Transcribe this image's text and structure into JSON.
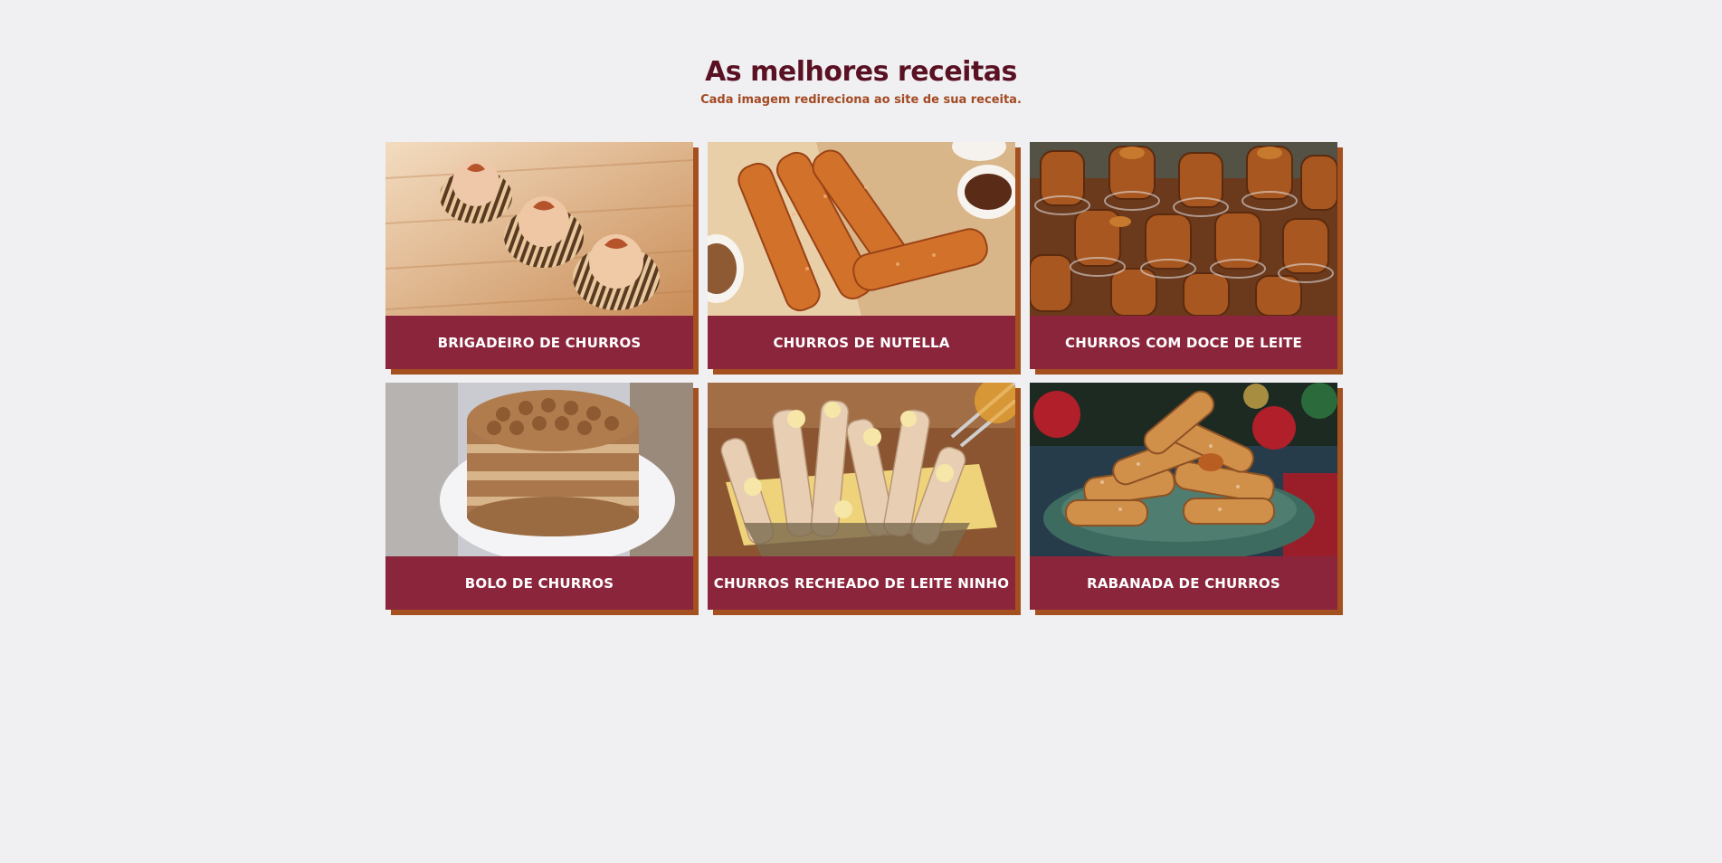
{
  "header": {
    "title": "As melhores receitas",
    "subtitle": "Cada imagem redireciona ao site de sua receita."
  },
  "recipes": [
    {
      "label": "BRIGADEIRO DE CHURROS"
    },
    {
      "label": "CHURROS DE NUTELLA"
    },
    {
      "label": "CHURROS COM DOCE DE LEITE"
    },
    {
      "label": "BOLO DE CHURROS"
    },
    {
      "label": "CHURROS RECHEADO DE LEITE NINHO"
    },
    {
      "label": "RABANADA DE CHURROS"
    }
  ],
  "colors": {
    "background": "#f0f0f2",
    "title": "#5a1123",
    "subtitle": "#a34a23",
    "card_label_bg": "#8b253c",
    "card_shadow": "#a4501f"
  }
}
